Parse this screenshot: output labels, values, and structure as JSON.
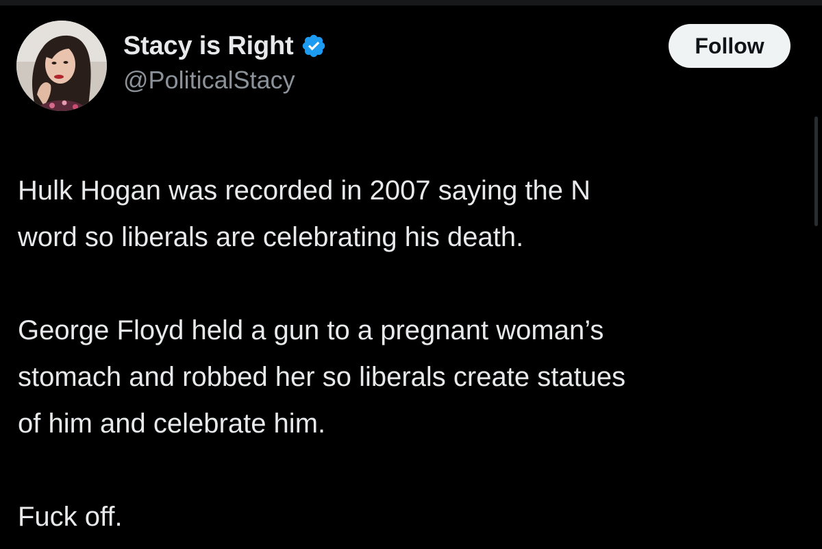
{
  "tweet": {
    "author": {
      "display_name": "Stacy is Right",
      "handle": "@PoliticalStacy",
      "verified": true,
      "avatar_icon": "profile-photo"
    },
    "follow_label": "Follow",
    "paragraphs": [
      "Hulk Hogan was recorded in 2007 saying the N\nword so liberals are celebrating his death.",
      "George Floyd held a gun to a pregnant woman’s\nstomach and robbed her so liberals create statues\nof him and celebrate him.",
      "Fuck off."
    ]
  },
  "colors": {
    "background": "#000000",
    "text_primary": "#e7e9ea",
    "text_secondary": "#8b9299",
    "verified_blue": "#1d9bf0",
    "follow_button_bg": "#eff3f4",
    "follow_button_text": "#0f1419"
  }
}
